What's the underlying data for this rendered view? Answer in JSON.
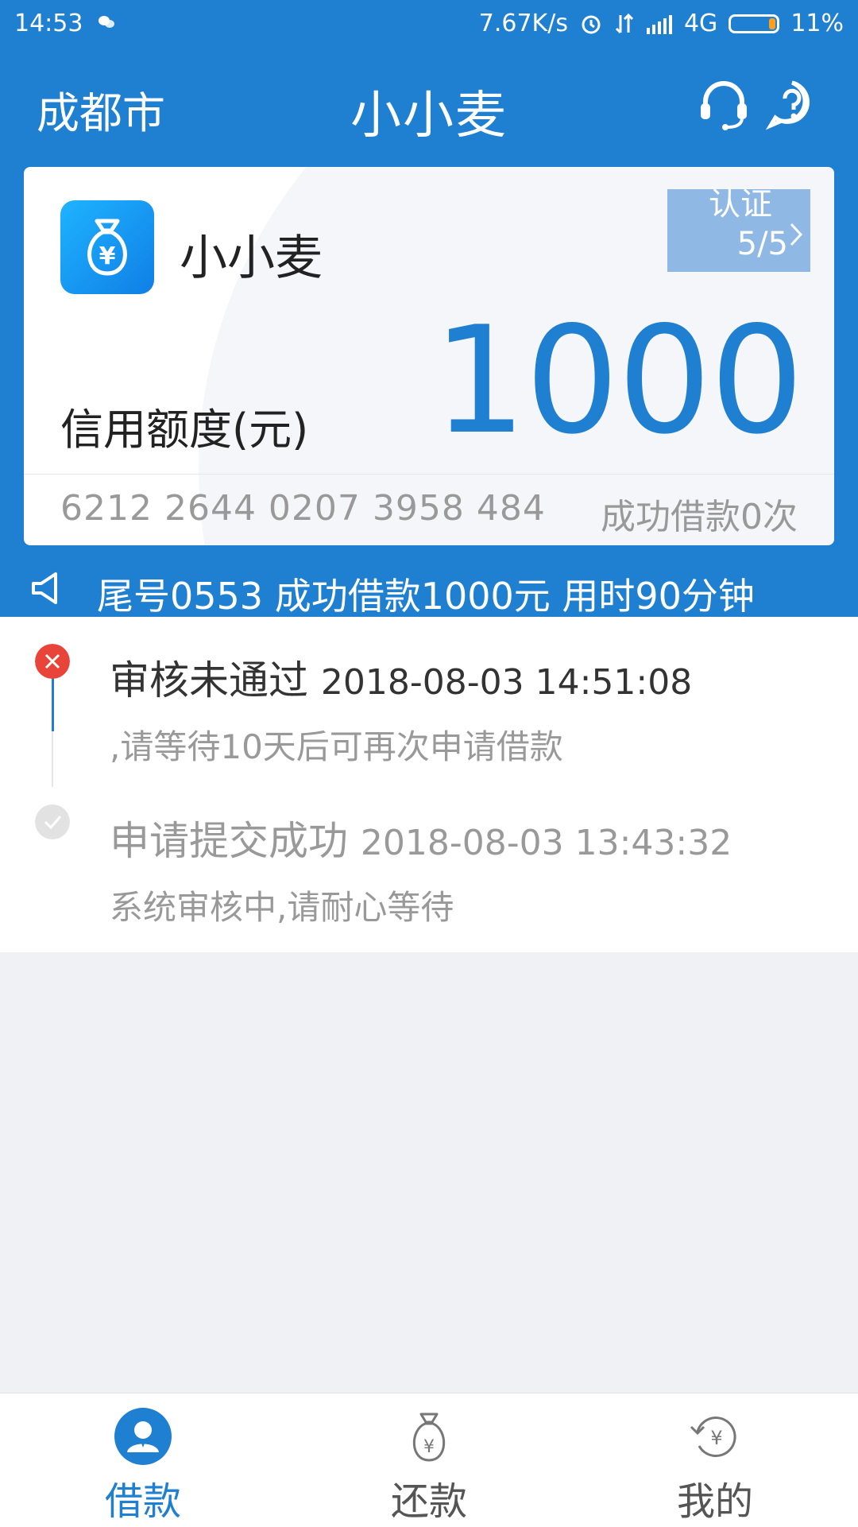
{
  "status_bar": {
    "time": "14:53",
    "network_speed": "7.67K/s",
    "network_type": "4G",
    "battery": "11%"
  },
  "header": {
    "city": "成都市",
    "title": "小小麦"
  },
  "card": {
    "app_name": "小小麦",
    "verify_label": "认证",
    "verify_count": "5/5",
    "limit_label": "信用额度(元)",
    "limit_value": "1000",
    "card_number": "6212 2644 0207 3958 484",
    "success_count": "成功借款0次"
  },
  "notice": {
    "text": "尾号0553 成功借款1000元 用时90分钟"
  },
  "timeline": [
    {
      "title": "审核未通过",
      "timestamp": "2018-08-03 14:51:08",
      "desc": ",请等待10天后可再次申请借款"
    },
    {
      "title": "申请提交成功",
      "timestamp": "2018-08-03 13:43:32",
      "desc": "系统审核中,请耐心等待"
    }
  ],
  "tabs": [
    {
      "label": "借款",
      "icon": "user-icon",
      "active": true
    },
    {
      "label": "还款",
      "icon": "money-bag-icon",
      "active": false
    },
    {
      "label": "我的",
      "icon": "refresh-yen-icon",
      "active": false
    }
  ],
  "colors": {
    "primary": "#1f7fd1",
    "error": "#e8443a",
    "battery_low": "#ff9f1a",
    "verify_bg": "#8fb8e4"
  }
}
